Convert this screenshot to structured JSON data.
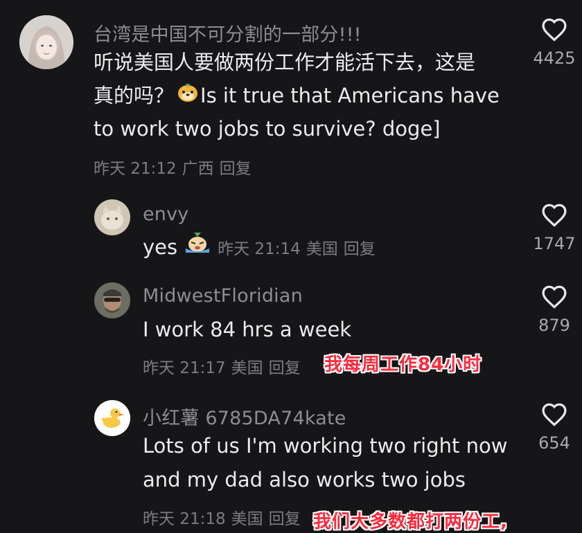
{
  "comments": [
    {
      "username": "台湾是中国不可分割的一部分!!!",
      "line1": "听说美国人要做两份工作才能活下去，这是",
      "line2_a": "真的吗？",
      "line2_b": "Is it true that Americans have",
      "line3": "to work two jobs to survive? doge]",
      "time": "昨天 21:12",
      "location": "广西",
      "reply": "回复",
      "likes": "4425"
    },
    {
      "username": "envy",
      "text": "yes",
      "time": "昨天 21:14",
      "location": "美国",
      "reply": "回复",
      "likes": "1747"
    },
    {
      "username": "MidwestFloridian",
      "text": "I work 84 hrs a week",
      "time": "昨天 21:17",
      "location": "美国",
      "reply": "回复",
      "likes": "879",
      "caption": "我每周工作84小时"
    },
    {
      "username": "小红薯 6785DA74kate",
      "line1": "Lots of us I'm working two right now",
      "line2": "and my dad also works two jobs",
      "time": "昨天 21:18",
      "location": "美国",
      "reply": "回复",
      "likes": "654",
      "caption": "我们大多数都打两份工,"
    }
  ],
  "icons": {
    "like": "heart-outline-icon",
    "avatar4": "duck-icon"
  },
  "colors": {
    "background": "#161618",
    "caption": "#ff2a3d"
  }
}
